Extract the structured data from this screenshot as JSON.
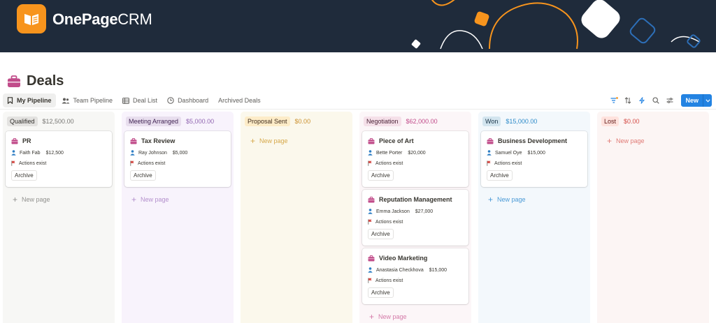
{
  "brand": {
    "name_bold": "OnePage",
    "name_light": "CRM",
    "logo_color": "#f7941d"
  },
  "page": {
    "title": "Deals"
  },
  "tabs": [
    {
      "label": "My Pipeline",
      "icon": "bookmark-icon",
      "active": true
    },
    {
      "label": "Team Pipeline",
      "icon": "people-icon",
      "active": false
    },
    {
      "label": "Deal List",
      "icon": "table-icon",
      "active": false
    },
    {
      "label": "Dashboard",
      "icon": "clock-icon",
      "active": false
    },
    {
      "label": "Archived Deals",
      "icon": "",
      "active": false
    }
  ],
  "toolbar": {
    "new_label": "New",
    "accent": "#2383e2"
  },
  "columns": [
    {
      "label": "Qualified",
      "sum": "$12,500.00",
      "bg": "#f7f7f5",
      "tag_bg": "#e3e2e0",
      "tag_color": "#32302c",
      "sum_color": "#787774",
      "muted": "#91918e",
      "cards": [
        {
          "title": "PR",
          "person": "Faith Fab",
          "amount": "$12,500",
          "actions": "Actions exist",
          "archive": "Archive"
        }
      ],
      "new_label": "New page"
    },
    {
      "label": "Meeting Arranged",
      "sum": "$5,000.00",
      "bg": "#f8f3fc",
      "tag_bg": "#e8deee",
      "tag_color": "#412454",
      "sum_color": "#9065b0",
      "muted": "#b38fcc",
      "cards": [
        {
          "title": "Tax Review",
          "person": "Ray Johnson",
          "amount": "$5,000",
          "actions": "Actions exist",
          "archive": "Archive"
        }
      ],
      "new_label": "New page"
    },
    {
      "label": "Proposal Sent",
      "sum": "$0.00",
      "bg": "#fbf8ec",
      "tag_bg": "#fdecc8",
      "tag_color": "#402c1b",
      "sum_color": "#cb912f",
      "muted": "#d6a84a",
      "cards": [],
      "new_label": "New page"
    },
    {
      "label": "Negotiation",
      "sum": "$62,000.00",
      "bg": "#fcf6f8",
      "tag_bg": "#f5e0e9",
      "tag_color": "#4c2337",
      "sum_color": "#c14c8a",
      "muted": "#d47aa8",
      "cards": [
        {
          "title": "Piece of Art",
          "person": "Bette Porter",
          "amount": "$20,000",
          "actions": "Actions exist",
          "archive": "Archive"
        },
        {
          "title": "Reputation Management",
          "person": "Emma Jackson",
          "amount": "$27,000",
          "actions": "Actions exist",
          "archive": "Archive"
        },
        {
          "title": "Video Marketing",
          "person": "Anastasia Checkhova",
          "amount": "$15,000",
          "actions": "Actions exist",
          "archive": "Archive"
        }
      ],
      "new_label": "New page"
    },
    {
      "label": "Won",
      "sum": "$15,000.00",
      "bg": "#f3f8fc",
      "tag_bg": "#d3e5ef",
      "tag_color": "#183347",
      "sum_color": "#2e8bc9",
      "muted": "#4a9ad6",
      "cards": [
        {
          "title": "Business Development",
          "person": "Samuel Oye",
          "amount": "$15,000",
          "actions": "Actions exist",
          "archive": "Archive"
        }
      ],
      "new_label": "New page"
    },
    {
      "label": "Lost",
      "sum": "$0.00",
      "bg": "#fcf5f4",
      "tag_bg": "#ffe2dd",
      "tag_color": "#5d1715",
      "sum_color": "#d44c47",
      "muted": "#e07a75",
      "cards": [],
      "new_label": "New page"
    }
  ],
  "icons": {
    "card": "briefcase-icon",
    "person": "person-icon",
    "actions": "flag-icon",
    "page_title": "briefcase-icon"
  },
  "colors": {
    "banner": "#1f2b3b",
    "briefcase": "#c14c8a",
    "person": "#2e7ec4",
    "flag": "#d44c47"
  }
}
